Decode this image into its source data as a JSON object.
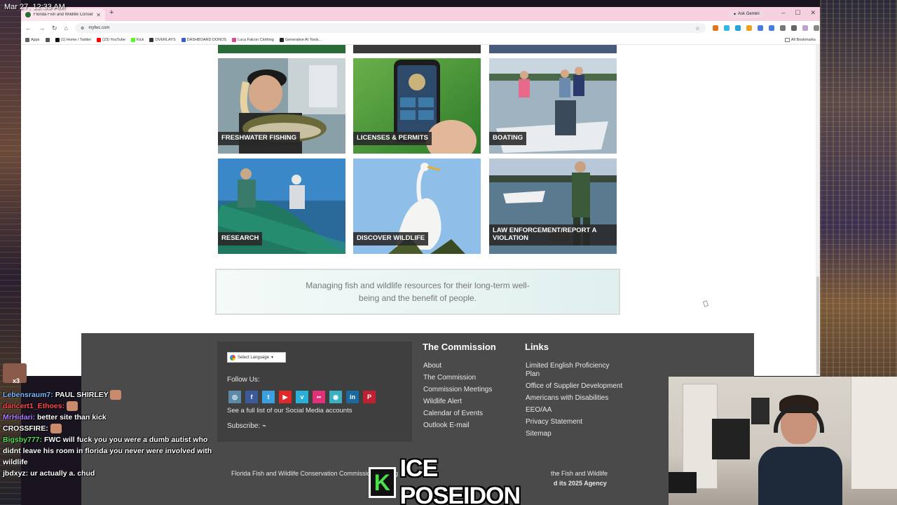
{
  "overlay": {
    "datetime": "Mar 27, 12:33 AM"
  },
  "browser": {
    "tab_title": "Florida Fish and Wildlife Conservation",
    "ask_gemini": "Ask Gemini",
    "url": "myfwc.com",
    "bookmarks": [
      {
        "label": "Apps",
        "color": "#5f6368"
      },
      {
        "label": "(1) Home / Twitter",
        "color": "#111111"
      },
      {
        "label": "(23) YouTube",
        "color": "#ff0000"
      },
      {
        "label": "Kick",
        "color": "#53fc18"
      },
      {
        "label": "OVERLAYS",
        "color": "#333333"
      },
      {
        "label": "DASHBOARD DONOS",
        "color": "#3a5bd9"
      },
      {
        "label": "Luca Falcon Clothing",
        "color": "#d94c8a"
      },
      {
        "label": "Generative AI Tools...",
        "color": "#222222"
      }
    ],
    "all_bookmarks": "All Bookmarks"
  },
  "tiles": [
    {
      "label": "FRESHWATER FISHING",
      "scene": "fishing"
    },
    {
      "label": "LICENSES & PERMITS",
      "scene": "licenses"
    },
    {
      "label": "BOATING",
      "scene": "boating"
    },
    {
      "label": "RESEARCH",
      "scene": "research"
    },
    {
      "label": "DISCOVER WILDLIFE",
      "scene": "wildlife"
    },
    {
      "label": "LAW ENFORCEMENT/REPORT A VIOLATION",
      "scene": "law"
    }
  ],
  "mission": "Managing fish and wildlife resources for their long-term well-being and the benefit of people.",
  "footer": {
    "select_language": "Select Language",
    "follow_us": "Follow Us:",
    "social_icons": [
      "instagram-icon",
      "facebook-icon",
      "twitter-icon",
      "youtube-icon",
      "vimeo-icon",
      "flickr-icon",
      "periscope-icon",
      "linkedin-icon",
      "pinterest-icon"
    ],
    "social_link": "See a full list of our Social Media accounts",
    "subscribe": "Subscribe:",
    "commission_title": "The Commission",
    "commission_links": [
      "About",
      "The Commission",
      "Commission Meetings",
      "Wildlife Alert",
      "Calendar of Events",
      "Outlook E-mail"
    ],
    "links_title": "Links",
    "links": [
      "Limited English Proficiency Plan",
      "Office of Supplier Development",
      "Americans with Disabilities",
      "EEO/AA",
      "Privacy Statement",
      "Sitemap"
    ],
    "bottom_left": "Florida Fish and Wildlife Conservation Commission Building",
    "bottom_right": "the Fish and Wildlife",
    "bottom_right_2": "d its 2025 Agency"
  },
  "chat": [
    {
      "user": "Lebensraum7:",
      "text": " PAUL SHIRLEY",
      "cls": "u1"
    },
    {
      "user": "dancert1_Ethoes:",
      "text": "",
      "cls": "u2"
    },
    {
      "user": "MrHidari:",
      "text": " better site than kick",
      "cls": "u3"
    },
    {
      "user": "CROSSFIRE:",
      "text": "",
      "cls": "u4"
    },
    {
      "user": "Bigsby777:",
      "text": " FWC will fuck you you were a dumb autist who didnt leave his room in florida you never were involved with wildlife",
      "cls": "u5"
    },
    {
      "user": "jbdxyz:",
      "text": " ur actually a. chud",
      "cls": "u6"
    }
  ],
  "avatar_badge": "x3",
  "brand": {
    "letter": "K",
    "name": "ICE POSEIDON"
  }
}
